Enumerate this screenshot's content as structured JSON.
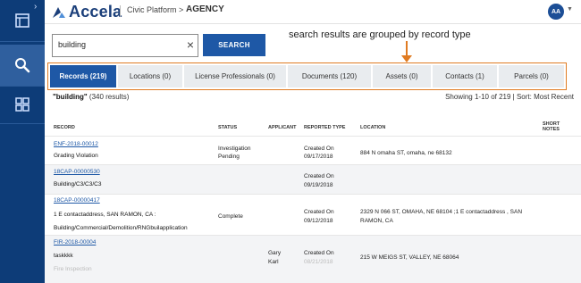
{
  "header": {
    "brand": "Accela",
    "crumb_platform": "Civic Platform",
    "crumb_sep": ">",
    "crumb_agency": "AGENCY",
    "avatar_initials": "AA"
  },
  "search": {
    "value": "building",
    "clear_glyph": "×",
    "button_label": "SEARCH"
  },
  "annotation": "search results are grouped by record type",
  "tabs": [
    {
      "label": "Records (219)",
      "active": true
    },
    {
      "label": "Locations (0)"
    },
    {
      "label": "License Professionals (0)"
    },
    {
      "label": "Documents (120)"
    },
    {
      "label": "Assets (0)"
    },
    {
      "label": "Contacts (1)"
    },
    {
      "label": "Parcels (0)"
    }
  ],
  "results": {
    "query_quoted": "\"building\"",
    "count_text": " (340 results)",
    "showing": "Showing 1-10 of 219 | Sort: Most Recent"
  },
  "columns": {
    "record": "RECORD",
    "status": "STATUS",
    "applicant": "APPLICANT",
    "reported_type": "REPORTED TYPE",
    "location": "LOCATION",
    "short": "SHORT",
    "notes": "NOTES"
  },
  "rows": [
    {
      "record_id": "ENF-2018-00012",
      "record_type": "Grading Violation",
      "status_1": "Investigation",
      "status_2": "Pending",
      "applicant_1": "",
      "applicant_2": "",
      "reported_1": "Created On",
      "reported_2": "09/17/2018",
      "location_1": "884 N omaha ST, omaha, ne 68132",
      "location_2": ""
    },
    {
      "record_id": "18CAP-00000530",
      "record_type": "Building/C3/C3/C3",
      "status_1": "",
      "status_2": "",
      "reported_1": "Created On",
      "reported_2": "09/19/2018"
    },
    {
      "record_id": "18CAP-00000417",
      "record_addr": "1 E contactaddress, SAN RAMON, CA :",
      "record_type": "Building/Commercial/Demolition/RNGbuilapplication",
      "status_1": "Complete",
      "reported_1": "Created On",
      "reported_2": "09/12/2018",
      "location_1": "2329 N 066 ST, OMAHA, NE 68104 ;1 E contactaddress , SAN",
      "location_2": "RAMON, CA"
    },
    {
      "record_id": "FIR-2018-00004",
      "record_sub": "taskkkk",
      "record_type": "Fire Inspection",
      "applicant_1": "Gary",
      "applicant_2": "Karl",
      "reported_1": "Created On",
      "reported_2": "08/21/2018",
      "location_1": "215 W MEIGS ST, VALLEY, NE 68064"
    }
  ]
}
